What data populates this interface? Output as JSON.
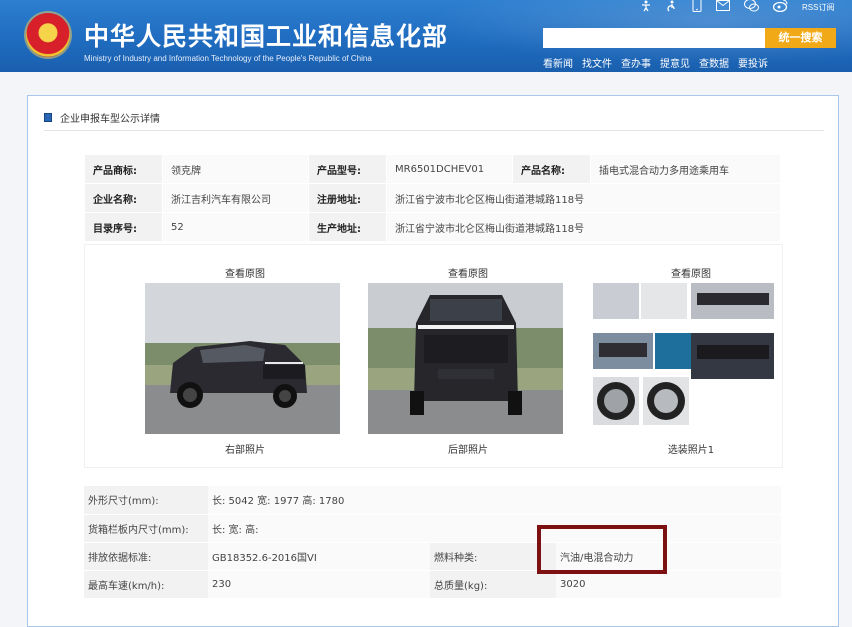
{
  "header": {
    "title": "中华人民共和国工业和信息化部",
    "subtitle": "Ministry of Industry and Information Technology of the People's Republic of China",
    "rss_label": "RSS订阅",
    "search_placeholder": "",
    "search_button": "统一搜索",
    "nav": [
      "看新闻",
      "找文件",
      "查办事",
      "提意见",
      "查数据",
      "要投诉"
    ],
    "top_icons": [
      "accessibility-icon",
      "mobile-icon",
      "mail-icon",
      "wechat-icon",
      "weibo-icon"
    ]
  },
  "panel": {
    "title": "企业申报车型公示详情"
  },
  "info": {
    "brand_label": "产品商标:",
    "brand": "领克牌",
    "model_label": "产品型号:",
    "model": "MR6501DCHEV01",
    "name_label": "产品名称:",
    "name": "插电式混合动力多用途乘用车",
    "company_label": "企业名称:",
    "company": "浙江吉利汽车有限公司",
    "reg_addr_label": "注册地址:",
    "reg_addr": "浙江省宁波市北仑区梅山街道港城路118号",
    "catalog_label": "目录序号:",
    "catalog": "52",
    "prod_addr_label": "生产地址:",
    "prod_addr": "浙江省宁波市北仑区梅山街道港城路118号"
  },
  "images": [
    {
      "top": "查看原图",
      "bottom": "右部照片"
    },
    {
      "top": "查看原图",
      "bottom": "后部照片"
    },
    {
      "top": "查看原图",
      "bottom": "选装照片1"
    }
  ],
  "details": {
    "size_label": "外形尺寸(mm):",
    "size": "长: 5042 宽: 1977 高: 1780",
    "cargo_label": "货箱栏板内尺寸(mm):",
    "cargo": "长:  宽:  高:",
    "emission_label": "排放依据标准:",
    "emission": "GB18352.6-2016国VI",
    "fuel_label": "燃料种类:",
    "fuel": "汽油/电混合动力",
    "speed_label": "最高车速(km/h):",
    "speed": "230",
    "mass_label": "总质量(kg):",
    "mass": "3020"
  },
  "colors": {
    "header_blue": "#1f6cc0",
    "search_button": "#f2a917",
    "highlight": "#7d1010",
    "panel_border": "#a9c7ea"
  }
}
